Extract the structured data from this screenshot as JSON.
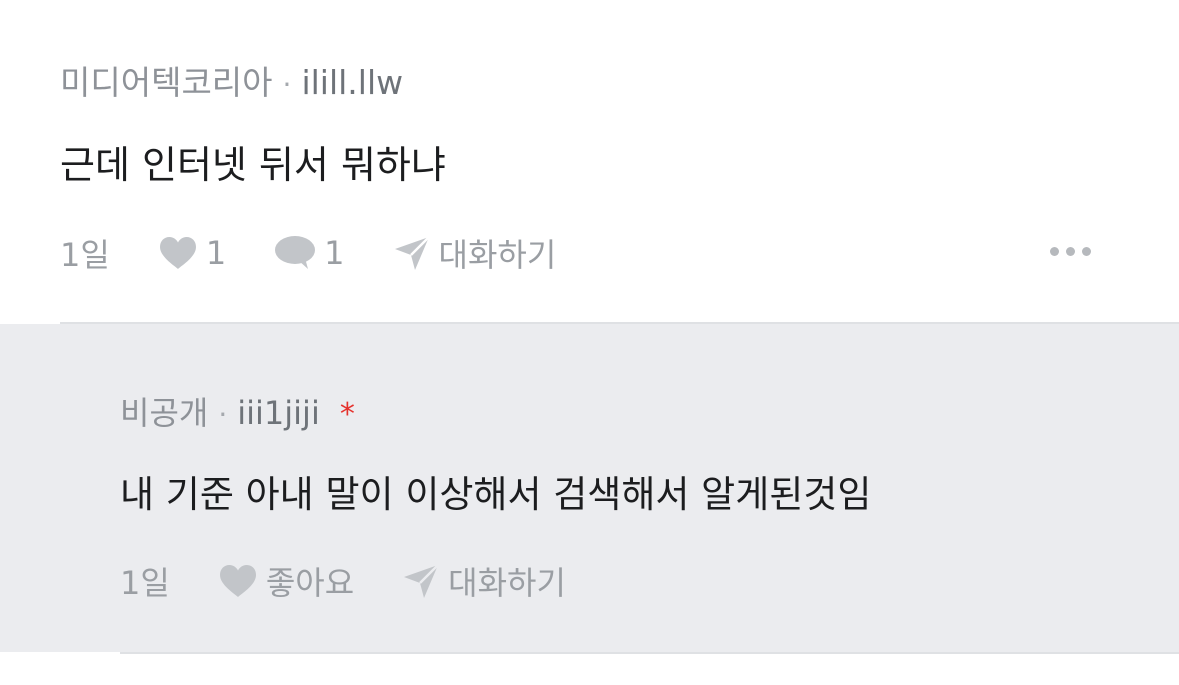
{
  "comment": {
    "author": "미디어텍코리아",
    "separator": "·",
    "handle": "ilill.llw",
    "text": "근데 인터넷 뒤서 뭐하냐",
    "age": "1일",
    "like_count": "1",
    "reply_count": "1",
    "talk_label": "대화하기",
    "more_icon": "more-dots-icon"
  },
  "reply": {
    "author": "비공개",
    "separator": "·",
    "handle": "iii1jiji",
    "marker": "*",
    "text": "내 기준 아내 말이 이상해서 검색해서 알게된것임",
    "age": "1일",
    "like_label": "좋아요",
    "talk_label": "대화하기"
  },
  "icons": {
    "like": "heart-icon",
    "comment": "speech-bubble-icon",
    "talk": "paper-plane-icon"
  },
  "colors": {
    "reply_background": "#ebecef",
    "icon_gray": "#c2c5c9",
    "asterisk": "#e5322d",
    "text_primary": "#1c1d1f",
    "text_muted": "#9a9ea3"
  }
}
